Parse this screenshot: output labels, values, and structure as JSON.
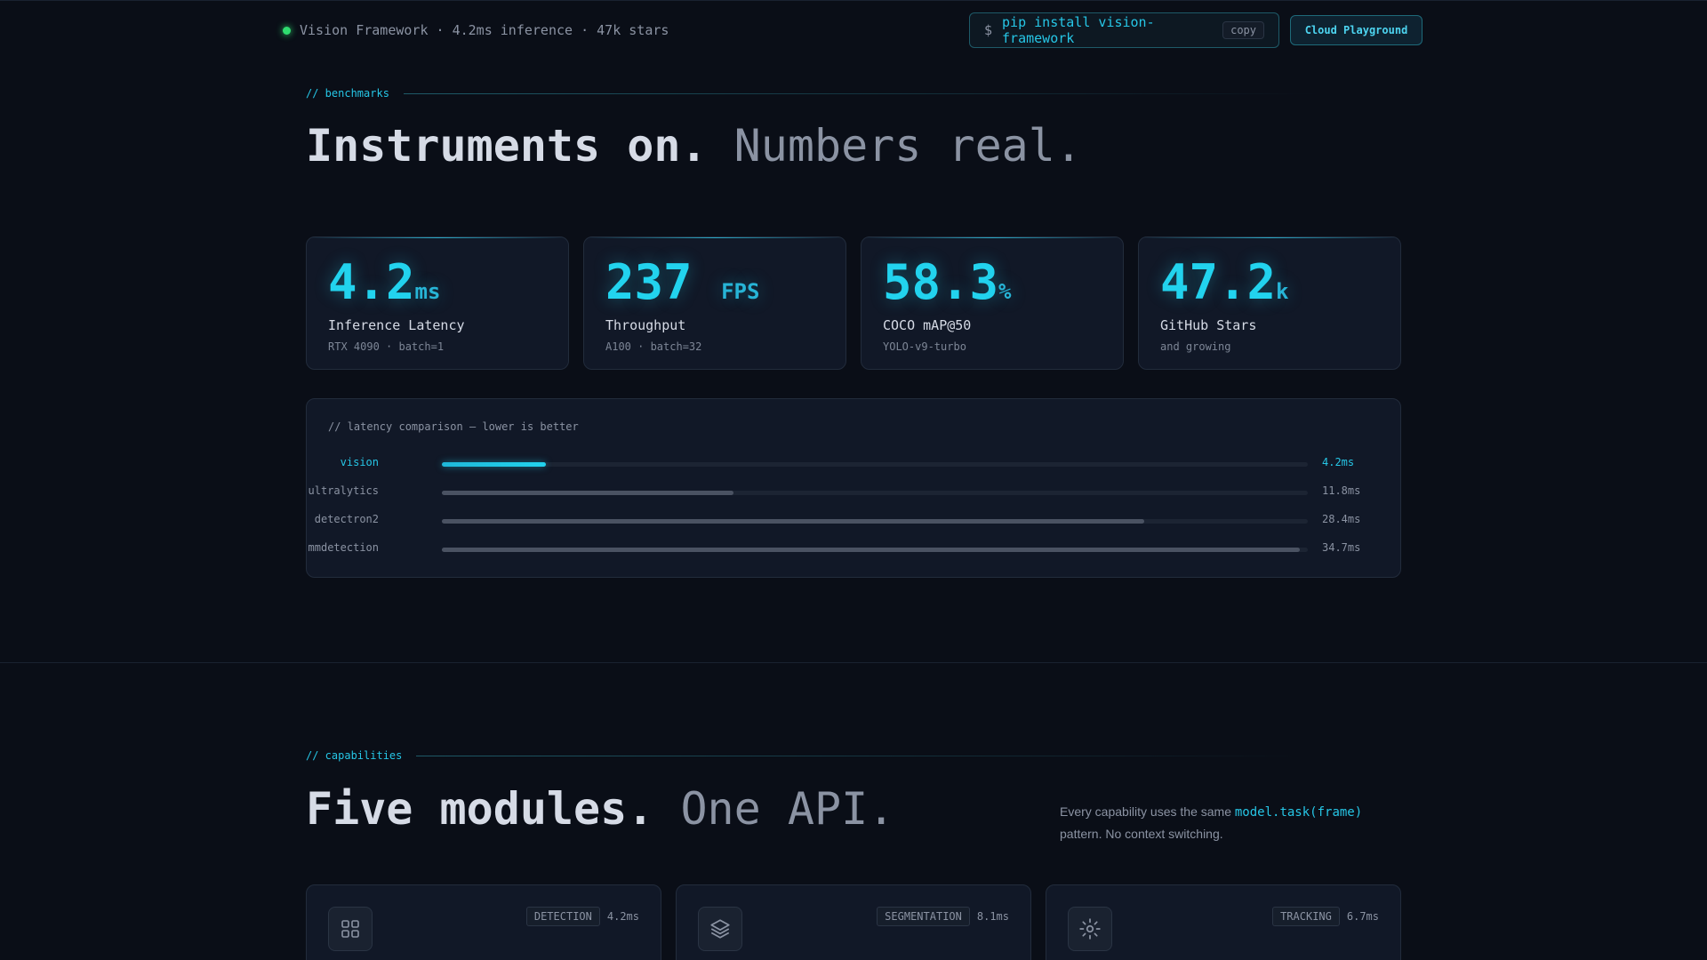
{
  "topbar": {
    "status_text": "Vision Framework · 4.2ms inference · 47k stars",
    "install_prompt": "$",
    "install_command": "pip install vision-framework",
    "copy_label": "copy",
    "cloud_label": "Cloud Playground"
  },
  "benchmarks": {
    "label": "// benchmarks",
    "headline_strong": "Instruments on.",
    "headline_dim": "Numbers real.",
    "stats": [
      {
        "value": "4.2",
        "unit": "ms",
        "title": "Inference Latency",
        "sub": "RTX 4090 · batch=1"
      },
      {
        "value": "237",
        "unit": "FPS",
        "title": "Throughput",
        "sub": "A100 · batch=32"
      },
      {
        "value": "58.3",
        "unit": "%",
        "title": "COCO mAP@50",
        "sub": "YOLO-v9-turbo"
      },
      {
        "value": "47.2",
        "unit": "k",
        "title": "GitHub Stars",
        "sub": "and growing"
      }
    ],
    "latency": {
      "title": "// latency comparison — lower is better",
      "rows": [
        {
          "name": "vision",
          "value_label": "4.2ms",
          "fill": 0.12
        },
        {
          "name": "ultralytics",
          "value_label": "11.8ms",
          "fill": 0.337
        },
        {
          "name": "detectron2",
          "value_label": "28.4ms",
          "fill": 0.811
        },
        {
          "name": "mmdetection",
          "value_label": "34.7ms",
          "fill": 0.991
        }
      ]
    }
  },
  "capabilities": {
    "label": "// capabilities",
    "headline_strong": "Five modules.",
    "headline_dim": "One API.",
    "desc_before": "Every capability uses the same ",
    "desc_code": "model.task(frame)",
    "desc_after": " pattern. No context switching.",
    "cards": [
      {
        "tag": "DETECTION",
        "time": "4.2ms",
        "icon": "grid-icon"
      },
      {
        "tag": "SEGMENTATION",
        "time": "8.1ms",
        "icon": "layers-icon"
      },
      {
        "tag": "TRACKING",
        "time": "6.7ms",
        "icon": "sun-icon"
      }
    ]
  },
  "colors": {
    "accent": "#22d3ee",
    "status": "#2fdc6f",
    "background": "#0a0e17"
  }
}
